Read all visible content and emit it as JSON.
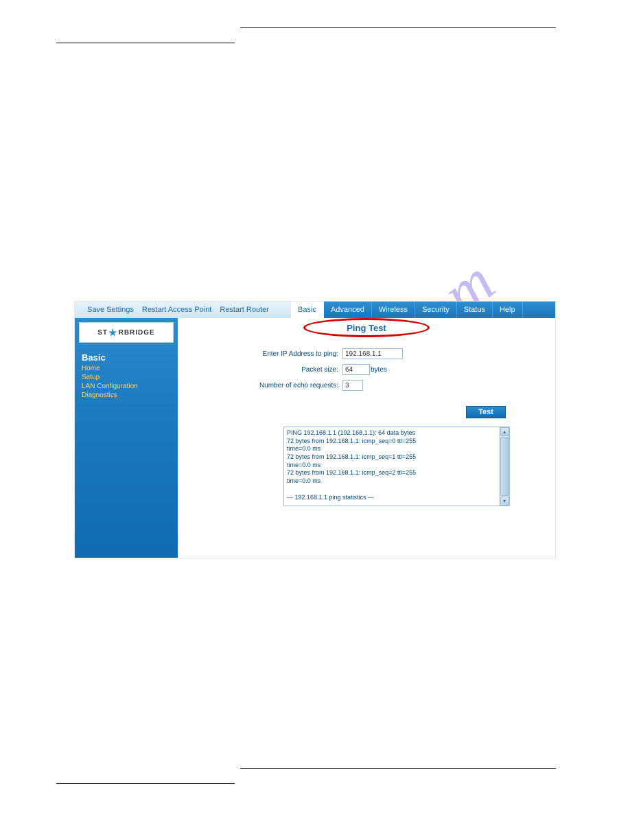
{
  "watermark": "manualshire.com",
  "topbar": {
    "save": "Save Settings",
    "restart_ap": "Restart Access Point",
    "restart_router": "Restart Router"
  },
  "tabs": {
    "basic": "Basic",
    "advanced": "Advanced",
    "wireless": "Wireless",
    "security": "Security",
    "status": "Status",
    "help": "Help"
  },
  "logo": {
    "left": "ST",
    "right": "RBRIDGE"
  },
  "sidebar": {
    "title": "Basic",
    "links": {
      "home": "Home",
      "setup": "Setup",
      "lan": "LAN Configuration",
      "diag": "Diagnostics"
    }
  },
  "ping": {
    "title": "Ping Test",
    "ip_label": "Enter IP Address to ping:",
    "ip_value": "192.168.1.1",
    "pkt_label": "Packet size:",
    "pkt_value": "64",
    "bytes": "bytes",
    "echo_label": "Number of echo requests:",
    "echo_value": "3",
    "test_btn": "Test",
    "output": "PING 192.168.1.1 (192.168.1.1): 64 data bytes\n72 bytes from 192.168.1.1: icmp_seq=0 ttl=255\ntime=0.0 ms\n72 bytes from 192.168.1.1: icmp_seq=1 ttl=255\ntime=0.0 ms\n72 bytes from 192.168.1.1: icmp_seq=2 ttl=255\ntime=0.0 ms\n\n--- 192.168.1.1 ping statistics ---"
  },
  "scroll": {
    "up": "▴",
    "down": "▾"
  }
}
